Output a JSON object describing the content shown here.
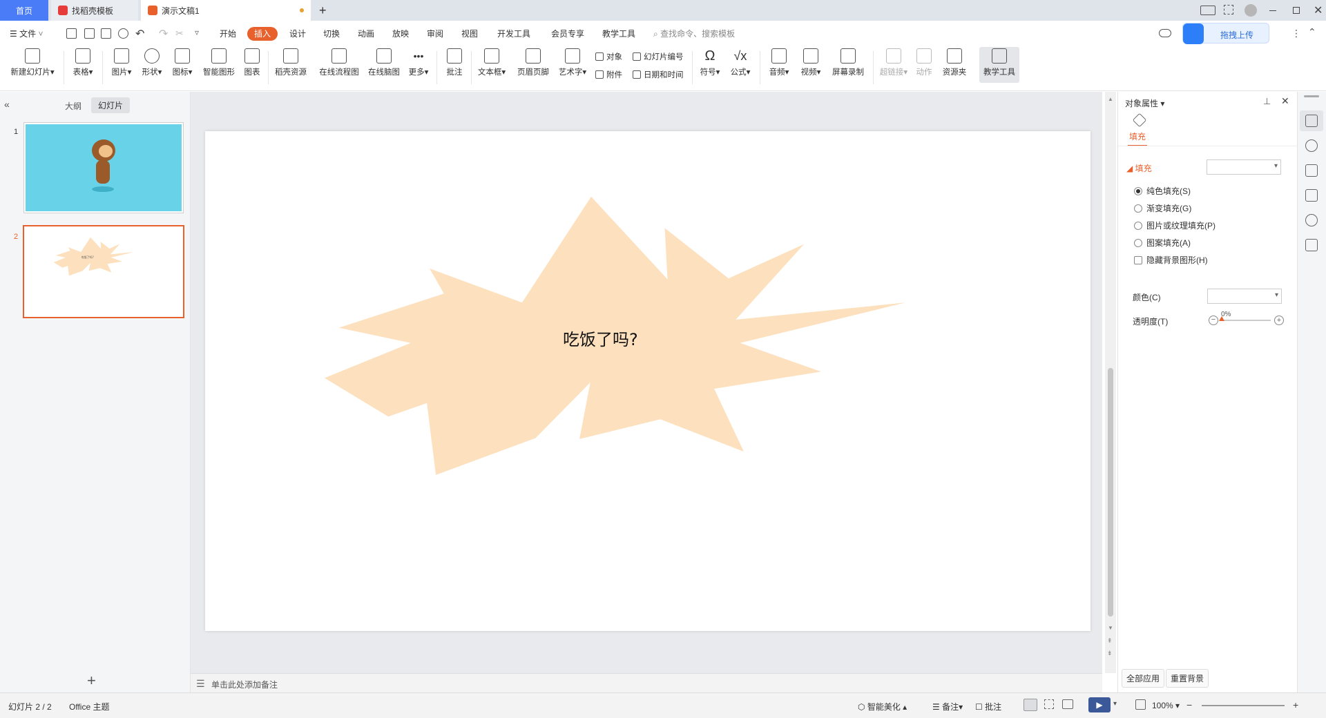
{
  "tabs": {
    "home": "首页",
    "template": "找稻壳模板",
    "doc": "演示文稿1",
    "add": "+"
  },
  "menubar": {
    "file": "文件",
    "items": [
      "开始",
      "插入",
      "设计",
      "切换",
      "动画",
      "放映",
      "审阅",
      "视图",
      "开发工具",
      "会员专享",
      "教学工具"
    ],
    "active_index": 1,
    "search_placeholder": "查找命令、搜索模板",
    "upload": "拖拽上传"
  },
  "ribbon": {
    "new_slide": "新建幻灯片",
    "table": "表格",
    "picture": "图片",
    "shape": "形状",
    "icon": "图标",
    "smart_graphic": "智能图形",
    "chart": "图表",
    "docer_resource": "稻壳资源",
    "online_flowchart": "在线流程图",
    "online_mindmap": "在线脑图",
    "more": "更多",
    "comment": "批注",
    "textbox": "文本框",
    "header_footer": "页眉页脚",
    "wordart": "艺术字",
    "object": "对象",
    "slide_number": "幻灯片编号",
    "attachment": "附件",
    "date_time": "日期和时间",
    "symbol": "符号",
    "formula": "公式",
    "audio": "音频",
    "video": "视频",
    "screen_record": "屏幕录制",
    "hyperlink": "超链接",
    "action": "动作",
    "resource_folder": "资源夹",
    "teaching_tools": "教学工具"
  },
  "leftpanel": {
    "outline": "大纲",
    "slides": "幻灯片",
    "slide_numbers": [
      "1",
      "2"
    ],
    "thumb_text": "吃饭了吗?",
    "add": "+"
  },
  "slide": {
    "text": "吃饭了吗?"
  },
  "notes": {
    "placeholder": "单击此处添加备注"
  },
  "rightpanel": {
    "title": "对象属性",
    "tab_fill": "填充",
    "section_fill": "填充",
    "options": [
      "纯色填充(S)",
      "渐变填充(G)",
      "图片或纹理填充(P)",
      "图案填充(A)"
    ],
    "hide_bg": "隐藏背景图形(H)",
    "color_label": "颜色(C)",
    "transparency_label": "透明度(T)",
    "transparency_value": "0%",
    "apply_all": "全部应用",
    "reset_bg": "重置背景"
  },
  "statusbar": {
    "slide_info": "幻灯片 2 / 2",
    "theme": "Office 主题",
    "smart_beautify": "智能美化",
    "notes": "备注",
    "comments": "批注",
    "zoom": "100%"
  },
  "colors": {
    "accent": "#e8602c",
    "slide1_bg": "#68d3e8",
    "burst": "#fde0bd",
    "tab_active": "#4a7cf7"
  }
}
